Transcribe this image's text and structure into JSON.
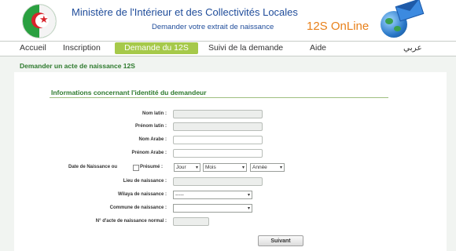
{
  "header": {
    "ministry_title": "Ministère de l'Intérieur et des Collectivités Locales",
    "subtitle": "Demander votre extrait de naissance",
    "brand": "12S OnLine"
  },
  "menu": {
    "items": [
      {
        "label": "Accueil"
      },
      {
        "label": "Inscription"
      },
      {
        "label": "Demande du 12S",
        "active": true
      },
      {
        "label": "Suivi de la demande"
      },
      {
        "label": "Aide"
      },
      {
        "label": "عربي"
      }
    ]
  },
  "page": {
    "heading": "Demander un acte de naissance 12S",
    "section_title": "Informations concernant l'identité du demandeur"
  },
  "form": {
    "nom_latin_label": "Nom latin :",
    "prenom_latin_label": "Prénom latin :",
    "nom_arabe_label": "Nom Arabe :",
    "prenom_arabe_label": "Prénom Arabe :",
    "date_label": "Date de Naissance ou",
    "presume_label": "Présumé :",
    "jour_value": "Jour",
    "mois_value": "Mois",
    "annee_value": "Année",
    "lieu_label": "Lieu de naissance :",
    "wilaya_label": "Wilaya de naissance :",
    "wilaya_value": "-----",
    "commune_label": "Commune de naissance :",
    "commune_value": "",
    "numero_label": "N° d'acte de naissance normal :",
    "submit_label": "Suivant"
  },
  "colors": {
    "accent_green": "#a6c94a",
    "heading_green": "#2e7a2e",
    "title_blue": "#1f4c9a",
    "brand_orange": "#e8801a"
  }
}
